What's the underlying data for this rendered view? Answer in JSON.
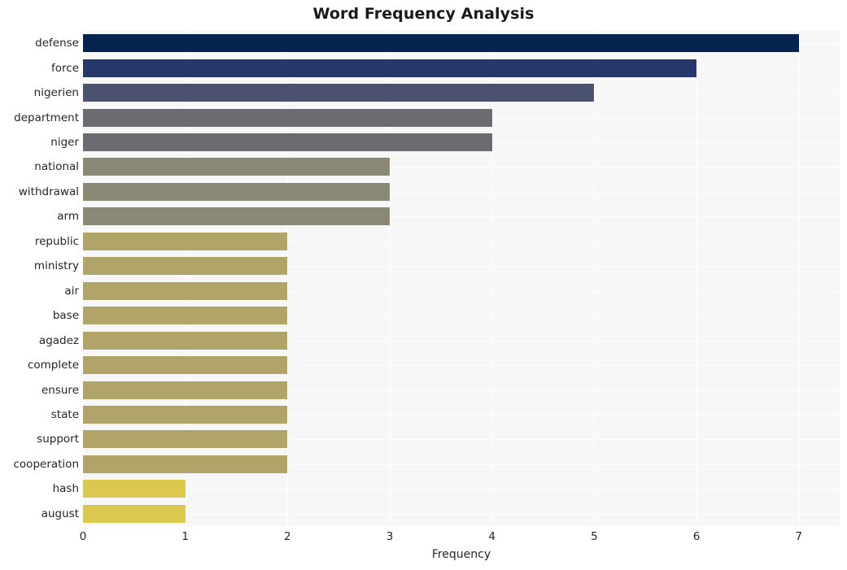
{
  "chart_data": {
    "type": "bar",
    "orientation": "horizontal",
    "title": "Word Frequency Analysis",
    "xlabel": "Frequency",
    "ylabel": "",
    "xlim": [
      0,
      7.4
    ],
    "xticks": [
      0,
      1,
      2,
      3,
      4,
      5,
      6,
      7
    ],
    "xtick_labels": [
      "0",
      "1",
      "2",
      "3",
      "4",
      "5",
      "6",
      "7"
    ],
    "grid": true,
    "grid_color": "#ffffff",
    "plot_background": "#f7f7f7",
    "legend": null,
    "categories": [
      "defense",
      "force",
      "nigerien",
      "department",
      "niger",
      "national",
      "withdrawal",
      "arm",
      "republic",
      "ministry",
      "air",
      "base",
      "agadez",
      "complete",
      "ensure",
      "state",
      "support",
      "cooperation",
      "hash",
      "august"
    ],
    "values": [
      7,
      6,
      5,
      4,
      4,
      3,
      3,
      3,
      2,
      2,
      2,
      2,
      2,
      2,
      2,
      2,
      2,
      2,
      1,
      1
    ],
    "bar_colors": [
      "#04234f",
      "#26386b",
      "#4a5270",
      "#6a6c72",
      "#6a6c72",
      "#8c8876",
      "#8c8876",
      "#8c8876",
      "#b0a468",
      "#b0a468",
      "#b0a468",
      "#b0a468",
      "#b0a468",
      "#b0a468",
      "#b0a468",
      "#b0a468",
      "#b0a468",
      "#b0a468",
      "#dcc84f",
      "#dcc84f"
    ],
    "colormap": "cividis"
  }
}
